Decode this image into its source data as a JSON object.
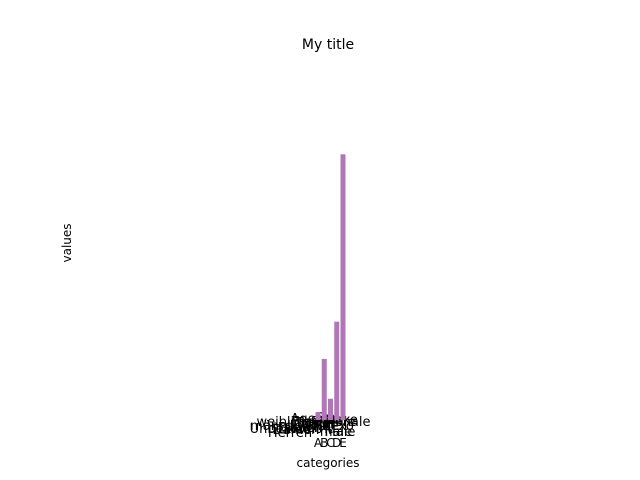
{
  "chart_data": {
    "type": "bar",
    "title": "My title",
    "xlabel": "categories",
    "ylabel": "values",
    "categories": [
      "A",
      "B",
      "C",
      "D",
      "E"
    ],
    "values": [
      3,
      23,
      8,
      37,
      100
    ],
    "ylim": [
      0,
      105
    ],
    "axes_visible": false,
    "grid": false,
    "bar_color": "#b077b7",
    "annotations": [
      "weiblich",
      "männlich",
      "Unbekannt",
      "Herren",
      "Damen",
      "female",
      "male",
      "other",
      "divers",
      "inconnu",
      "Agender",
      "Trans",
      "NB",
      "Frauen",
      "Frau",
      "sexe",
      "sexo",
      "Sex",
      "Female",
      "Male"
    ]
  }
}
